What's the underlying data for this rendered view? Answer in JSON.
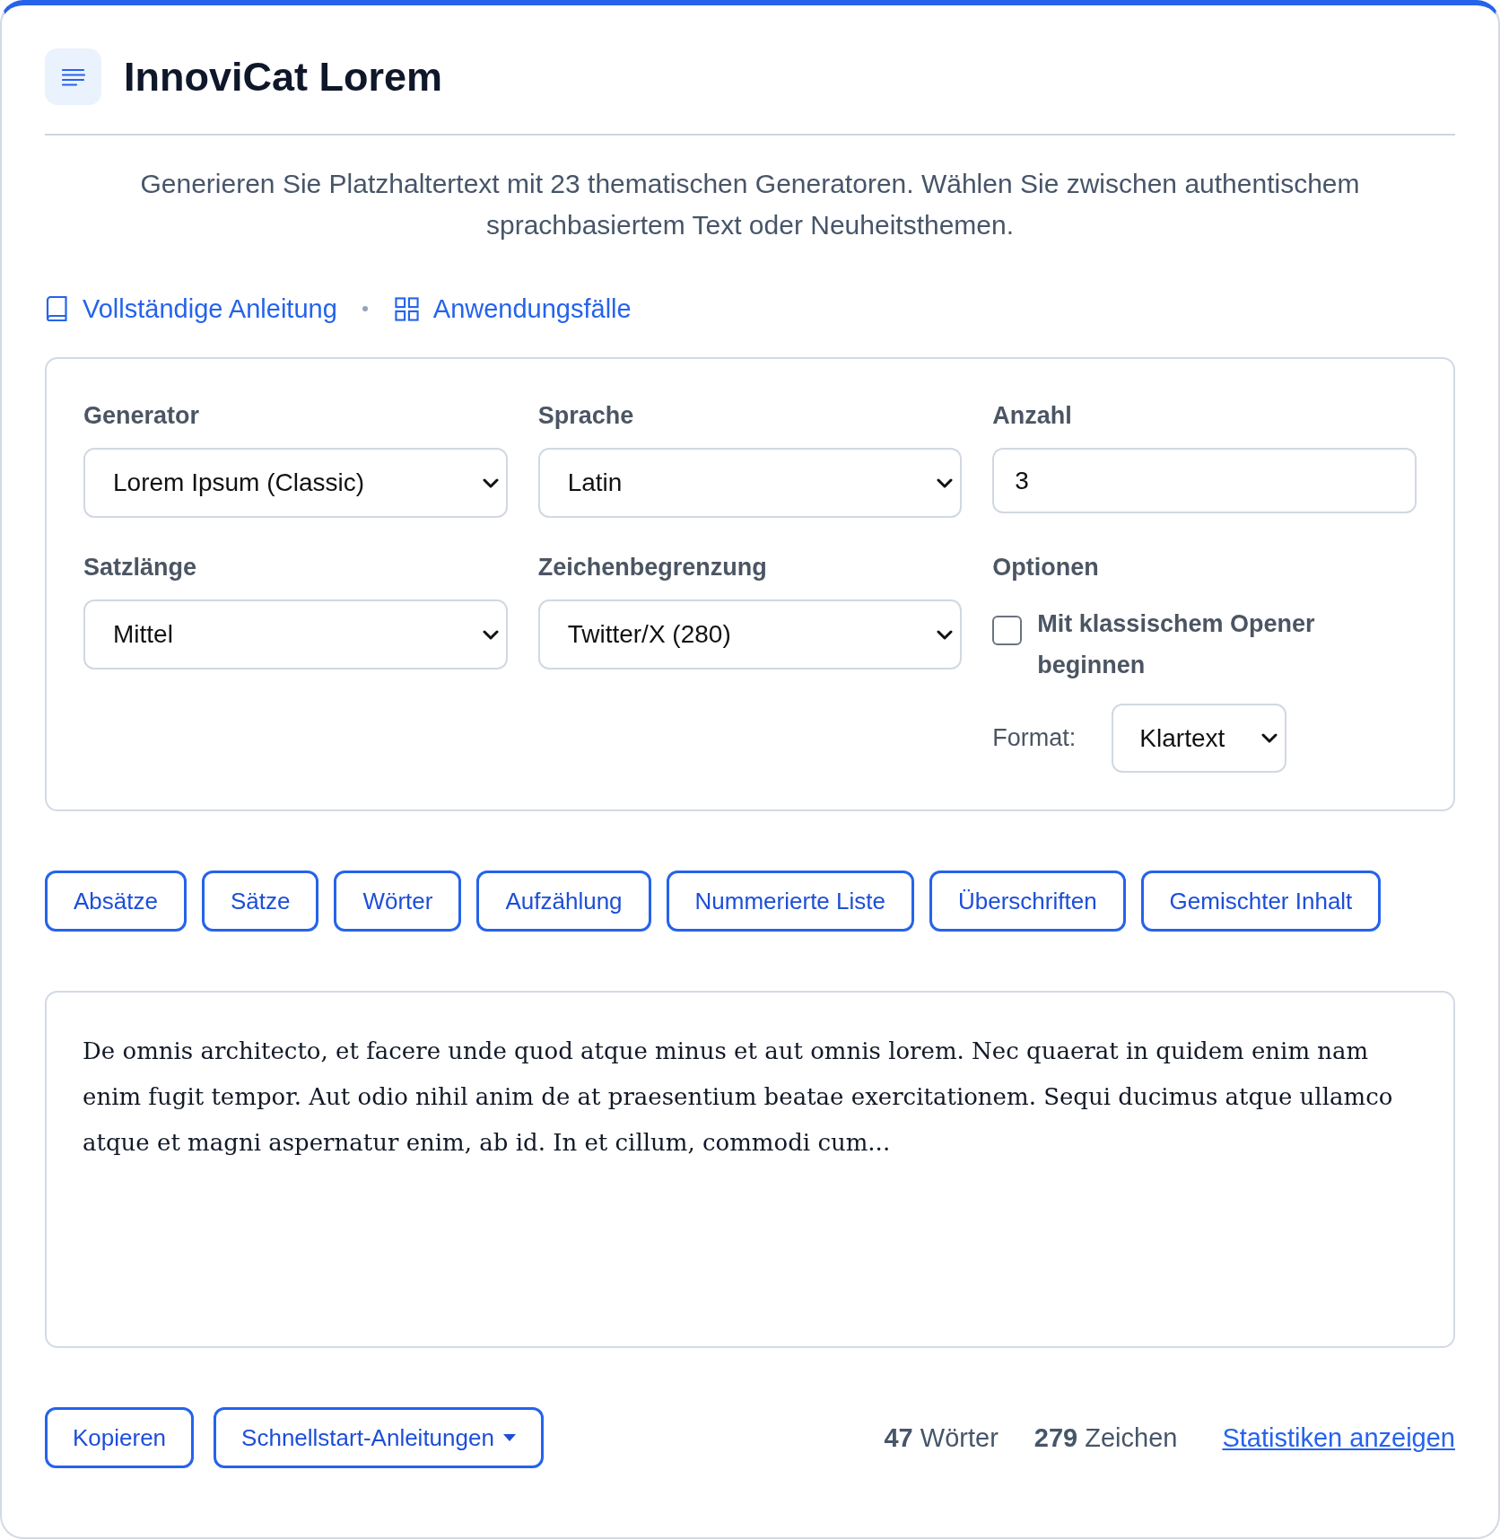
{
  "header": {
    "title": "InnoviCat Lorem"
  },
  "description": "Generieren Sie Platzhaltertext mit 23 thematischen Generatoren. Wählen Sie zwischen authentischem sprachbasiertem Text oder Neuheitsthemen.",
  "links": [
    {
      "label": "Vollständige Anleitung"
    },
    {
      "label": "Anwendungsfälle"
    }
  ],
  "settings": {
    "fields": [
      {
        "kind": "select",
        "label": "Generator",
        "value": "Lorem Ipsum (Classic)"
      },
      {
        "kind": "select",
        "label": "Sprache",
        "value": "Latin"
      },
      {
        "kind": "number",
        "label": "Anzahl",
        "value": "3"
      },
      {
        "kind": "select",
        "label": "Satzlänge",
        "value": "Mittel"
      },
      {
        "kind": "select",
        "label": "Zeichenbegrenzung",
        "value": "Twitter/X (280)"
      },
      {
        "kind": "options",
        "label": "Optionen",
        "checkbox": {
          "label": "Mit klassischem Opener beginnen",
          "checked": false
        },
        "format": {
          "label": "Format:",
          "value": "Klartext"
        }
      }
    ]
  },
  "generate_buttons": [
    "Absätze",
    "Sätze",
    "Wörter",
    "Aufzählung",
    "Nummerierte Liste",
    "Überschriften",
    "Gemischter Inhalt"
  ],
  "output": {
    "text": "De omnis architecto, et facere unde quod atque minus et aut omnis lorem. Nec quaerat in quidem enim nam enim fugit tempor. Aut odio nihil anim de at praesentium beatae exercitationem. Sequi ducimus atque ullamco atque et magni aspernatur enim, ab id. In et cillum, commodi cum..."
  },
  "footer": {
    "buttons": [
      {
        "label": "Kopieren",
        "dropdown": false
      },
      {
        "label": "Schnellstart-Anleitungen",
        "dropdown": true
      }
    ],
    "stats": [
      {
        "count": "47",
        "unit": "Wörter"
      },
      {
        "count": "279",
        "unit": "Zeichen"
      }
    ],
    "link": "Statistiken anzeigen"
  }
}
